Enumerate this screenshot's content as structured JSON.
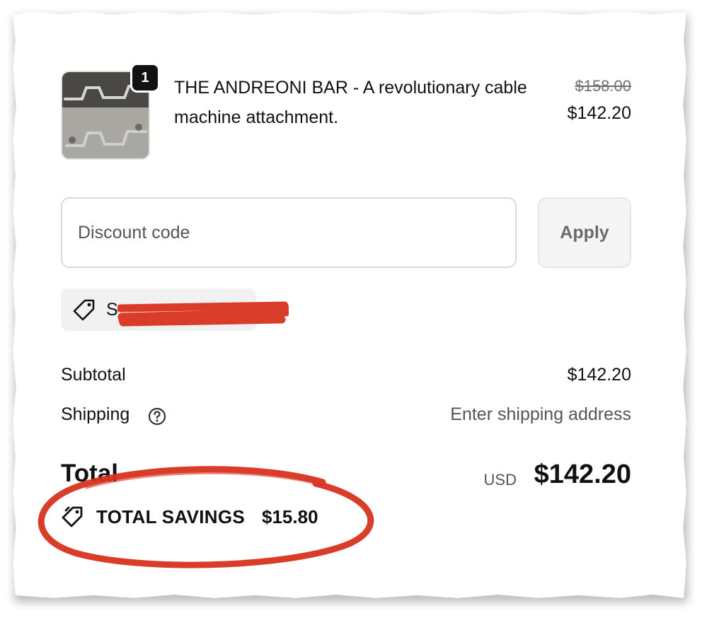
{
  "product": {
    "quantity": "1",
    "title": "THE ANDREONI BAR - A revolutionary cable machine attachment.",
    "original_price": "$158.00",
    "sale_price": "$142.20",
    "thumbnail_icon": "product-photo-bar"
  },
  "discount": {
    "placeholder": "Discount code",
    "apply_label": "Apply",
    "applied_code_visible": "S",
    "applied_code_icon": "tag-icon"
  },
  "summary": {
    "subtotal_label": "Subtotal",
    "subtotal_value": "$142.20",
    "shipping_label": "Shipping",
    "shipping_help_icon": "question-circle-icon",
    "shipping_value": "Enter shipping address",
    "total_label": "Total",
    "total_currency": "USD",
    "total_value": "$142.20",
    "savings_label": "TOTAL SAVINGS",
    "savings_value": "$15.80",
    "savings_icon": "tags-icon"
  },
  "colors": {
    "annotation_red": "#d8321f",
    "badge_black": "#111111",
    "muted_text": "#555555"
  }
}
